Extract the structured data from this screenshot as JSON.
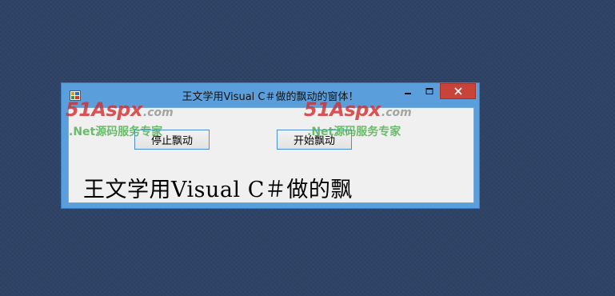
{
  "window": {
    "title": "王文学用Visual C＃做的飘动的窗体！",
    "close_glyph": "✕"
  },
  "buttons": {
    "stop_label": "停止飘动",
    "start_label": "开始飘动"
  },
  "label": {
    "text": "王文学用Visual C＃做的飘"
  },
  "watermark": {
    "logo": "51Aspx",
    "domain": ".com",
    "tagline": ".Net源码服务专家"
  },
  "colors": {
    "desktop": "#2e4366",
    "window_frame": "#5a9fdc",
    "close_button": "#c8443a",
    "client_area": "#f0f0f0",
    "watermark_red": "#d22d2d",
    "watermark_green": "#46aa46"
  },
  "icons": {
    "app": "app-icon",
    "minimize": "minimize-icon",
    "maximize": "maximize-icon",
    "close": "close-icon"
  }
}
